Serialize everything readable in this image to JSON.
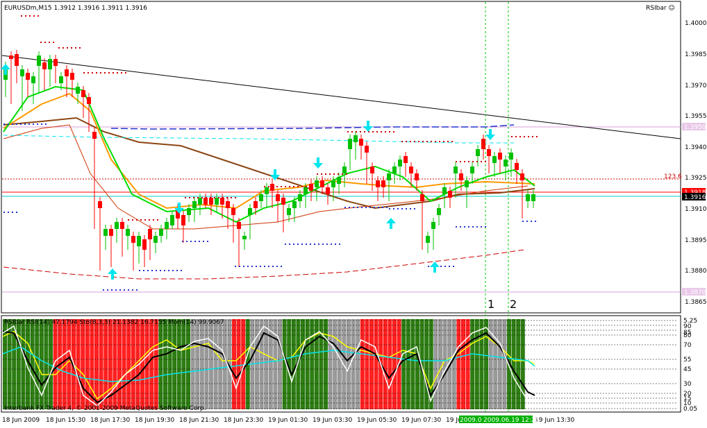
{
  "window": {
    "symbol_header": "EURUSDm,M15  1.3912 1.3916 1.3911 1.3916",
    "indicator_name": "RSIbar ☺",
    "copyright": "Interbank FX Trader 4, © 2001-2009 MetaQuotes Software Corp."
  },
  "main_chart": {
    "price_ticks": [
      "1.4000",
      "1.3985",
      "1.3970",
      "1.3955",
      "1.3940",
      "1.3925",
      "1.3910",
      "1.3895",
      "1.3880",
      "1.3865"
    ],
    "tag_1950": "1.3950",
    "tag_1870": "1.3870",
    "tag_1918": "1.3918",
    "current_price": "1.3916",
    "fib_label": "123.6",
    "marker_1": "1",
    "marker_2": "2"
  },
  "sub_window": {
    "header": "RSIbar RSI(14) 47.1794  Sto(8,3,3) 21.1382 16.7155  Mom(14) 99.9067",
    "level_ticks": [
      "5.25",
      "90",
      "85",
      "80",
      "70",
      "55",
      "45",
      "30",
      "20",
      "15",
      "10",
      "0.05"
    ]
  },
  "time_axis": {
    "labels": [
      "18 Jun 2009",
      "18 Jun 15:30",
      "18 Jun 17:30",
      "18 Jun 19:30",
      "18 Jun 21:30",
      "18 Jun 23:30",
      "19 Jun 01:30",
      "19 Jun 03:30",
      "19 Jun 05:30",
      "19 Jun 07:30",
      "19 Jun",
      "19 Jun 13:30"
    ],
    "cursor_label": "2009.06.19 12:25",
    "cursor_left_label": "2009.0"
  },
  "colors": {
    "bull": "#00c000",
    "bear": "#ff0000",
    "rsi_green": "#2d7d13",
    "rsi_red": "#ff2020",
    "rsi_gray": "#999999",
    "cyan": "#00e5ee",
    "stoch_yellow": "#ffff00"
  },
  "icons": {
    "up_arrow": "cyan-up-arrow",
    "down_arrow": "cyan-down-arrow",
    "smiley": "smiley-icon"
  }
}
